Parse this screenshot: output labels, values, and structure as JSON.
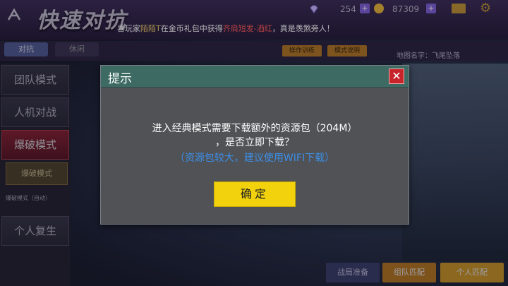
{
  "header": {
    "title": "快速对抗",
    "gems": "254",
    "coins": "87309",
    "plus_label": "+"
  },
  "ticker": {
    "prefix": "喜玩家",
    "player": "陌陌T",
    "middle": "在金币礼包中获得",
    "item": "齐肩短发-酒红",
    "suffix": "，真是羡煞旁人！"
  },
  "tabs": [
    {
      "label": "对抗"
    },
    {
      "label": "休闲"
    }
  ],
  "toolbar": {
    "btn1": "操作训练",
    "btn2": "模式说明",
    "map_name": "地图名字：飞尾坠落"
  },
  "sidebar": {
    "items": [
      {
        "label": "团队模式"
      },
      {
        "label": "人机对战"
      },
      {
        "label": "爆破模式"
      },
      {
        "label": "个人复生"
      }
    ],
    "sub_selected": "爆破模式",
    "sub_auto": "爆破模式（自动）"
  },
  "bottom": {
    "team_label": "战局准备",
    "match_label": "组队匹配",
    "solo_label": "个人匹配"
  },
  "dialog": {
    "title": "提示",
    "close_glyph": "✕",
    "line1": "进入经典模式需要下载额外的资源包（204M）",
    "line2": "，是否立即下载？",
    "line3": "（资源包较大，建议使用WIFI下载）",
    "confirm_label": "确定"
  },
  "colors": {
    "dialog_header": "#3d6a63",
    "confirm": "#f2d20c",
    "notice_blue": "#3c8ee6",
    "close_red": "#c7232a"
  }
}
